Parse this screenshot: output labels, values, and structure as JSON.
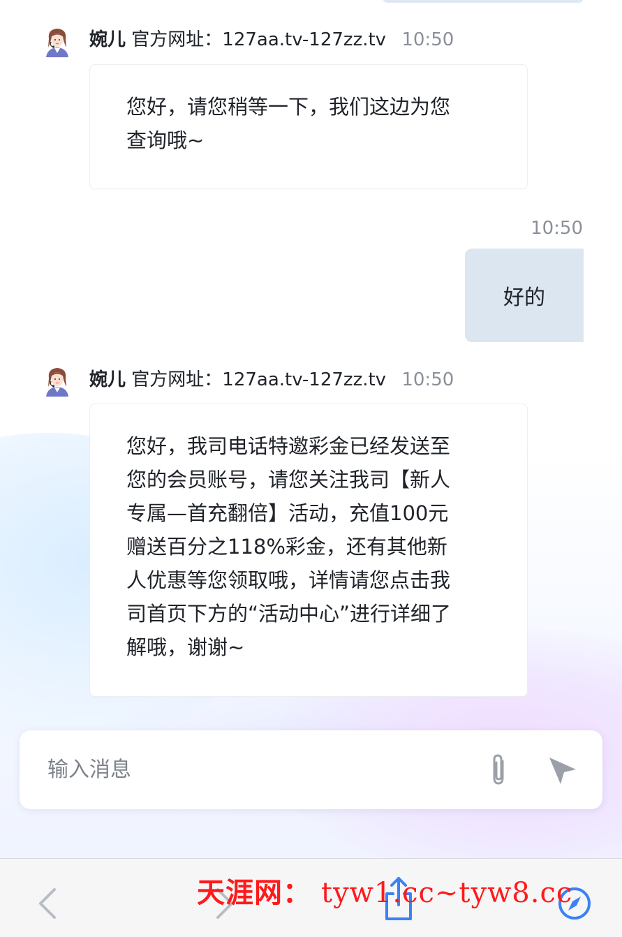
{
  "colors": {
    "user_bubble": "#dce6f1",
    "agent_bubble": "#ffffff",
    "timestamp": "#8a8f99",
    "watermark": "#ff1a1a",
    "icon_gray": "#9ba0a8",
    "toolbar_blue": "#3b82f6"
  },
  "messages": [
    {
      "role": "agent",
      "sender": "婉儿",
      "url": "官方网址：127aa.tv-127zz.tv",
      "time": "10:50",
      "text": "您好，请您稍等一下，我们这边为您\n查询哦~"
    },
    {
      "role": "user",
      "time": "10:50",
      "text": "好的"
    },
    {
      "role": "agent",
      "sender": "婉儿",
      "url": "官方网址：127aa.tv-127zz.tv",
      "time": "10:50",
      "text": "您好，我司电话特邀彩金已经发送至\n您的会员账号，请您关注我司【新人\n专属—首充翻倍】活动，充值100元\n赠送百分之118%彩金，还有其他新\n人优惠等您领取哦，详情请您点击我\n司首页下方的“活动中心”进行详细了\n解哦，谢谢~"
    }
  ],
  "input": {
    "placeholder": "输入消息",
    "attach_icon": "paperclip-icon",
    "send_icon": "send-icon"
  },
  "toolbar": {
    "icons": [
      "back-arrow-icon",
      "forward-arrow-icon",
      "share-icon",
      "compass-icon"
    ]
  },
  "watermark": {
    "label": "天涯网：",
    "urls": "tyw1.cc~tyw8.cc"
  }
}
